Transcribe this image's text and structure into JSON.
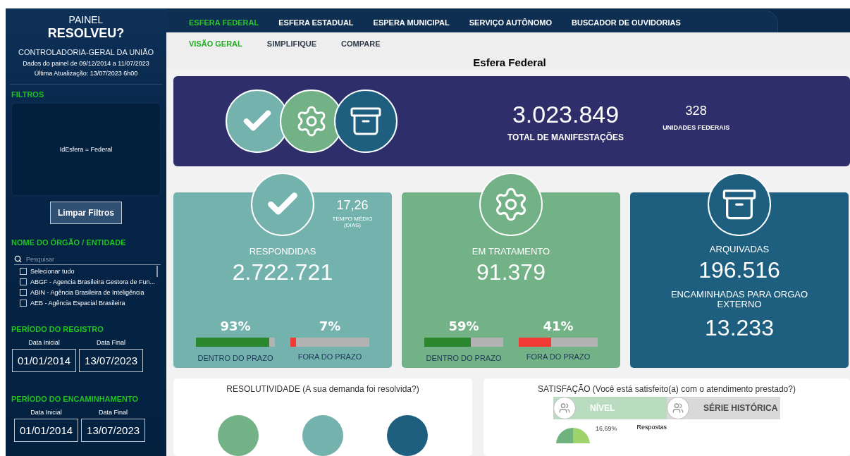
{
  "sidebar": {
    "header": {
      "title": "PAINEL",
      "subtitle": "RESOLVEU?",
      "org": "CONTROLADORIA-GERAL DA UNIÃO",
      "data_range": "Dados do painel de 09/12/2014 a 11/07/2023",
      "last_update": "Última Atualização: 13/07/2023 6h00"
    },
    "filters": {
      "title": "FILTROS",
      "applied": "IdEsfera = Federal",
      "clear_button": "Limpar Filtros"
    },
    "entity": {
      "title": "NOME DO ÓRGÃO / ENTIDADE",
      "search_placeholder": "Pesquisar",
      "items": [
        {
          "label": "Selecionar tudo",
          "checked": false
        },
        {
          "label": "ABGF - Agencia Brasileira Gestora de Fun...",
          "checked": false
        },
        {
          "label": "ABIN - Agência Brasileira de Inteligência",
          "checked": false
        },
        {
          "label": "AEB - Agência Espacial Brasileira",
          "checked": false
        }
      ]
    },
    "periods": [
      {
        "title": "PERÍODO DO REGISTRO",
        "start_label": "Data Inicial",
        "start": "01/01/2014",
        "end_label": "Data Final",
        "end": "13/07/2023"
      },
      {
        "title": "PERÍODO DO ENCAMINHAMENTO",
        "start_label": "Data Inicial",
        "start": "01/01/2014",
        "end_label": "Data Final",
        "end": "13/07/2023"
      }
    ]
  },
  "nav_tabs": [
    {
      "label": "ESFERA FEDERAL",
      "selected": true
    },
    {
      "label": "ESFERA ESTADUAL",
      "selected": false
    },
    {
      "label": "ESPERA MUNICIPAL",
      "selected": false
    },
    {
      "label": "SERVIÇO AUTÔNOMO",
      "selected": false
    },
    {
      "label": "BUSCADOR DE OUVIDORIAS",
      "selected": false
    }
  ],
  "sub_tabs": [
    {
      "label": "VISÃO GERAL",
      "selected": true
    },
    {
      "label": "SIMPLIFIQUE",
      "selected": false
    },
    {
      "label": "COMPARE",
      "selected": false
    }
  ],
  "page_title": "Esfera Federal",
  "summary": {
    "total": "3.023.849",
    "total_label": "TOTAL DE MANIFESTAÇÕES",
    "units": "328",
    "units_label": "UNIDADES FEDERAIS"
  },
  "cards": [
    {
      "kind": "responded",
      "title": "RESPONDIDAS",
      "value": "2.722.721",
      "average": "17,26",
      "average_label": "TEMPO MÉDIO (DIAS)",
      "bars": [
        {
          "kind": "on_time",
          "percent": "93%",
          "level": 0.93,
          "label": "DENTRO DO PRAZO"
        },
        {
          "kind": "late",
          "percent": "7%",
          "level": 0.07,
          "label": "FORA DO PRAZO"
        }
      ]
    },
    {
      "kind": "in_progress",
      "title": "EM TRATAMENTO",
      "value": "91.379",
      "bars": [
        {
          "kind": "on_time",
          "percent": "59%",
          "level": 0.59,
          "label": "DENTRO DO PRAZO"
        },
        {
          "kind": "late",
          "percent": "41%",
          "level": 0.41,
          "label": "FORA DO PRAZO"
        }
      ]
    },
    {
      "kind": "archived",
      "title": "ARQUIVADAS",
      "value": "196.516",
      "extra_label": "ENCAMINHADAS PARA ORGAO EXTERNO",
      "extra_value": "13.233"
    }
  ],
  "resolutividade": {
    "title": "RESOLUTIVIDADE (A sua demanda foi resolvida?)"
  },
  "satisfacao": {
    "title": "SATISFAÇÃO (Você está satisfeito(a) com o atendimento prestado?)",
    "toggles": [
      {
        "label": "NÍVEL",
        "selected": true
      },
      {
        "label": "SÉRIE HISTÓRICA",
        "selected": false
      }
    ],
    "pie_label": "16,69%",
    "legend_title": "Respostas"
  }
}
